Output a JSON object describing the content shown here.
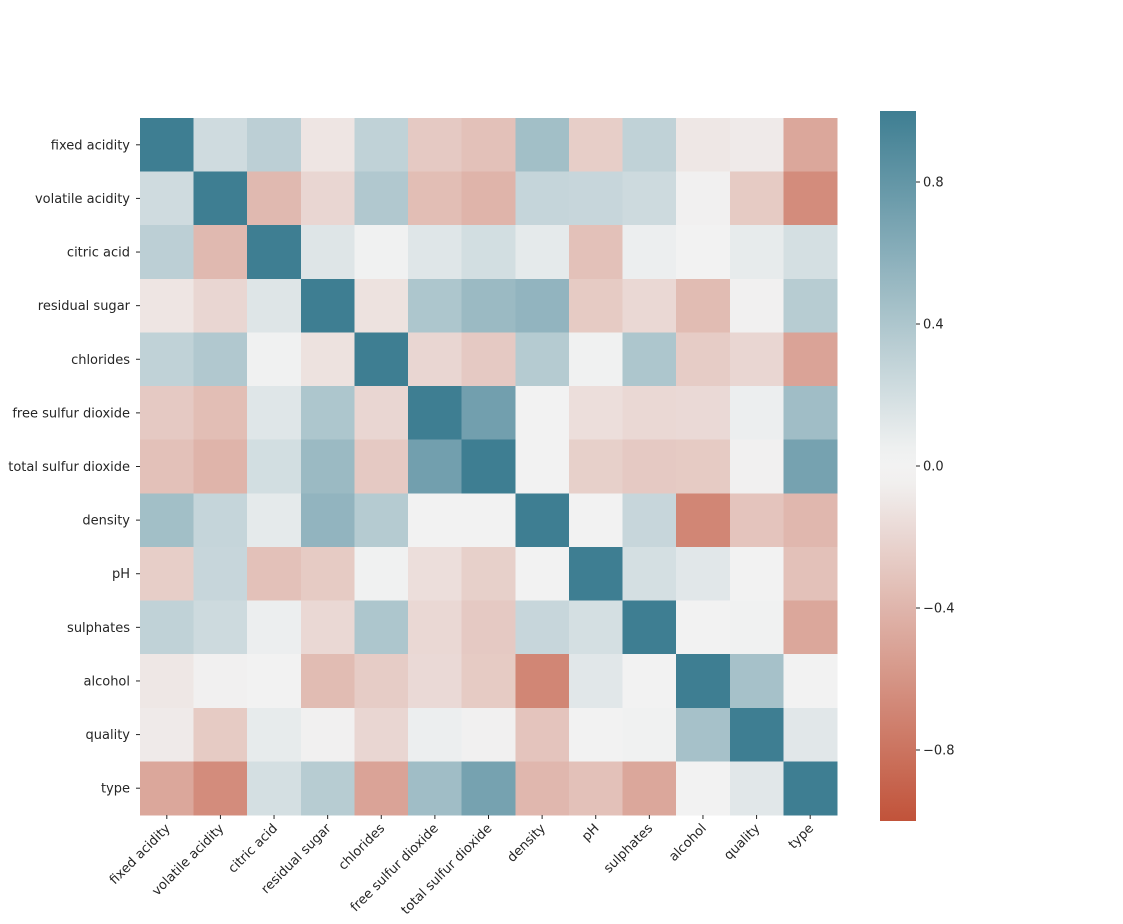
{
  "chart_data": {
    "type": "heatmap",
    "title": "",
    "xlabel": "",
    "ylabel": "",
    "x_labels": [
      "fixed acidity",
      "volatile acidity",
      "citric acid",
      "residual sugar",
      "chlorides",
      "free sulfur dioxide",
      "total sulfur dioxide",
      "density",
      "pH",
      "sulphates",
      "alcohol",
      "quality",
      "type"
    ],
    "y_labels": [
      "fixed acidity",
      "volatile acidity",
      "citric acid",
      "residual sugar",
      "chlorides",
      "free sulfur dioxide",
      "total sulfur dioxide",
      "density",
      "pH",
      "sulphates",
      "alcohol",
      "quality",
      "type"
    ],
    "values": [
      [
        1.0,
        0.22,
        0.32,
        -0.11,
        0.3,
        -0.28,
        -0.33,
        0.46,
        -0.25,
        0.3,
        -0.1,
        -0.08,
        -0.49
      ],
      [
        0.22,
        1.0,
        -0.38,
        -0.2,
        0.38,
        -0.35,
        -0.41,
        0.27,
        0.26,
        0.23,
        -0.04,
        -0.27,
        -0.65
      ],
      [
        0.32,
        -0.38,
        1.0,
        0.14,
        0.04,
        0.13,
        0.2,
        0.1,
        -0.33,
        0.06,
        -0.01,
        0.09,
        0.19
      ],
      [
        -0.11,
        -0.2,
        0.14,
        1.0,
        -0.13,
        0.4,
        0.5,
        0.55,
        -0.27,
        -0.19,
        -0.36,
        -0.04,
        0.35
      ],
      [
        0.3,
        0.38,
        0.04,
        -0.13,
        1.0,
        -0.2,
        -0.28,
        0.36,
        0.04,
        0.4,
        -0.26,
        -0.2,
        -0.51
      ],
      [
        -0.28,
        -0.35,
        0.13,
        0.4,
        -0.2,
        1.0,
        0.72,
        0.03,
        -0.15,
        -0.19,
        -0.18,
        0.06,
        0.47
      ],
      [
        -0.33,
        -0.41,
        0.2,
        0.5,
        -0.28,
        0.72,
        1.0,
        0.03,
        -0.24,
        -0.28,
        -0.27,
        -0.04,
        0.7
      ],
      [
        0.46,
        0.27,
        0.1,
        0.55,
        0.36,
        0.03,
        0.03,
        1.0,
        0.01,
        0.26,
        -0.69,
        -0.31,
        -0.39
      ],
      [
        -0.25,
        0.26,
        -0.33,
        -0.27,
        0.04,
        -0.15,
        -0.24,
        0.01,
        1.0,
        0.19,
        0.12,
        0.02,
        -0.33
      ],
      [
        0.3,
        0.23,
        0.06,
        -0.19,
        0.4,
        -0.19,
        -0.28,
        0.26,
        0.19,
        1.0,
        0.0,
        0.04,
        -0.49
      ],
      [
        -0.1,
        -0.04,
        -0.01,
        -0.36,
        -0.26,
        -0.18,
        -0.27,
        -0.69,
        0.12,
        0.0,
        1.0,
        0.44,
        0.03
      ],
      [
        -0.08,
        -0.27,
        0.09,
        -0.04,
        -0.2,
        0.06,
        -0.04,
        -0.31,
        0.02,
        0.04,
        0.44,
        1.0,
        0.12
      ],
      [
        -0.49,
        -0.65,
        0.19,
        0.35,
        -0.51,
        0.47,
        0.7,
        -0.39,
        -0.33,
        -0.49,
        0.03,
        0.12,
        1.0
      ]
    ],
    "colorbar": {
      "vmin": -1.0,
      "vmax": 1.0,
      "ticks": [
        0.8,
        0.4,
        0.0,
        -0.4,
        -0.8
      ],
      "tick_labels": [
        "0.8",
        "0.4",
        "0.0",
        "−0.4",
        "−0.8"
      ]
    },
    "colormap": {
      "positive": "#3e7e92",
      "neutral": "#f2f2f2",
      "negative": "#c1533a"
    },
    "grid": false,
    "legend": "colorbar-right"
  }
}
